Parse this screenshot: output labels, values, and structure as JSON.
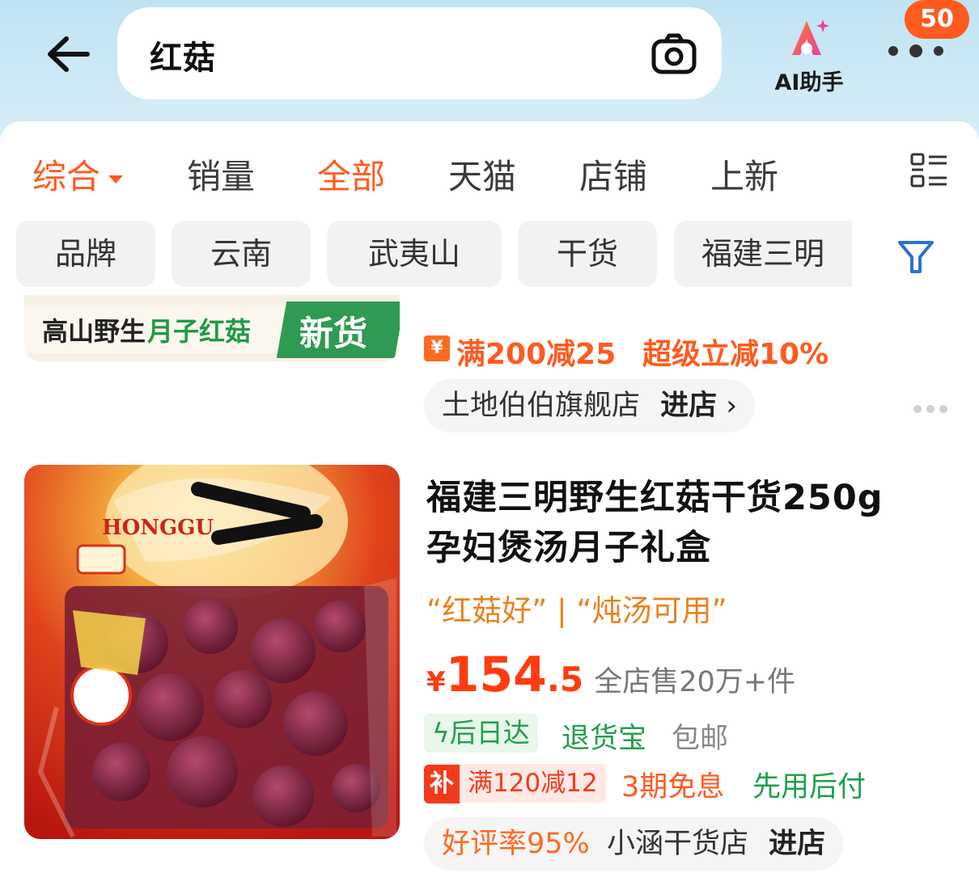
{
  "search": {
    "query": "红菇"
  },
  "header": {
    "ai_label": "AI助手",
    "badge_count": "50"
  },
  "sort_tabs": [
    "综合",
    "销量",
    "全部",
    "天猫",
    "店铺",
    "上新"
  ],
  "filter_chips": [
    "品牌",
    "云南",
    "武夷山",
    "干货",
    "福建三明"
  ],
  "product1": {
    "image_text_main": "高山野生",
    "image_text_green": "月子红菇",
    "image_badge": "新货",
    "promo_coupon": "满200减25",
    "promo_discount": "超级立减10%",
    "store_name": "土地伯伯旗舰店",
    "store_enter": "进店"
  },
  "product2": {
    "title_line1": "福建三明野生红菇干货250g",
    "title_line2": "孕妇煲汤月子礼盒",
    "quote": "“红菇好” | “炖汤可用”",
    "price_symbol": "¥",
    "price_int": "154",
    "price_dec": ".5",
    "sales": "全店售20万+件",
    "shipping_tag": "后日达",
    "return_tag": "退货宝",
    "free_ship": "包邮",
    "subsidy_label": "补",
    "subsidy_text": "满120减12",
    "installment": "3期免息",
    "pay_later": "先用后付",
    "rating": "好评率95%",
    "store_name": "小涵干货店",
    "store_enter": "进店"
  },
  "colors": {
    "accent": "#ff5a1f",
    "price": "#ff3b10",
    "green": "#1fa04a",
    "quote": "#e8821d"
  }
}
